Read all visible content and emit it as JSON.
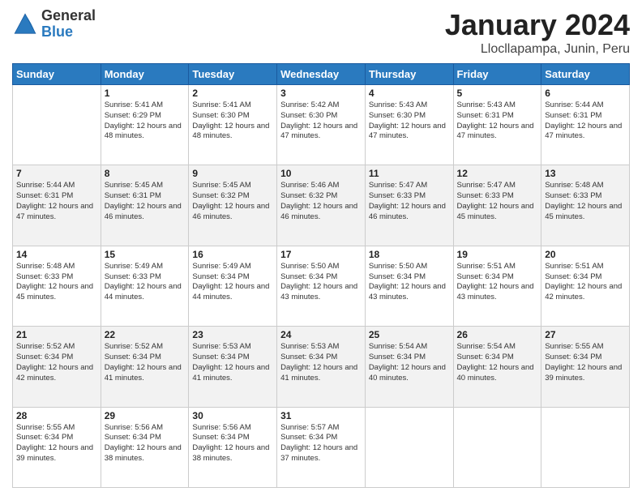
{
  "logo": {
    "general": "General",
    "blue": "Blue"
  },
  "title": {
    "month": "January 2024",
    "location": "Llocllapampa, Junin, Peru"
  },
  "days_header": [
    "Sunday",
    "Monday",
    "Tuesday",
    "Wednesday",
    "Thursday",
    "Friday",
    "Saturday"
  ],
  "weeks": [
    [
      {
        "day": "",
        "sunrise": "",
        "sunset": "",
        "daylight": ""
      },
      {
        "day": "1",
        "sunrise": "Sunrise: 5:41 AM",
        "sunset": "Sunset: 6:29 PM",
        "daylight": "Daylight: 12 hours and 48 minutes."
      },
      {
        "day": "2",
        "sunrise": "Sunrise: 5:41 AM",
        "sunset": "Sunset: 6:30 PM",
        "daylight": "Daylight: 12 hours and 48 minutes."
      },
      {
        "day": "3",
        "sunrise": "Sunrise: 5:42 AM",
        "sunset": "Sunset: 6:30 PM",
        "daylight": "Daylight: 12 hours and 47 minutes."
      },
      {
        "day": "4",
        "sunrise": "Sunrise: 5:43 AM",
        "sunset": "Sunset: 6:30 PM",
        "daylight": "Daylight: 12 hours and 47 minutes."
      },
      {
        "day": "5",
        "sunrise": "Sunrise: 5:43 AM",
        "sunset": "Sunset: 6:31 PM",
        "daylight": "Daylight: 12 hours and 47 minutes."
      },
      {
        "day": "6",
        "sunrise": "Sunrise: 5:44 AM",
        "sunset": "Sunset: 6:31 PM",
        "daylight": "Daylight: 12 hours and 47 minutes."
      }
    ],
    [
      {
        "day": "7",
        "sunrise": "Sunrise: 5:44 AM",
        "sunset": "Sunset: 6:31 PM",
        "daylight": "Daylight: 12 hours and 47 minutes."
      },
      {
        "day": "8",
        "sunrise": "Sunrise: 5:45 AM",
        "sunset": "Sunset: 6:31 PM",
        "daylight": "Daylight: 12 hours and 46 minutes."
      },
      {
        "day": "9",
        "sunrise": "Sunrise: 5:45 AM",
        "sunset": "Sunset: 6:32 PM",
        "daylight": "Daylight: 12 hours and 46 minutes."
      },
      {
        "day": "10",
        "sunrise": "Sunrise: 5:46 AM",
        "sunset": "Sunset: 6:32 PM",
        "daylight": "Daylight: 12 hours and 46 minutes."
      },
      {
        "day": "11",
        "sunrise": "Sunrise: 5:47 AM",
        "sunset": "Sunset: 6:33 PM",
        "daylight": "Daylight: 12 hours and 46 minutes."
      },
      {
        "day": "12",
        "sunrise": "Sunrise: 5:47 AM",
        "sunset": "Sunset: 6:33 PM",
        "daylight": "Daylight: 12 hours and 45 minutes."
      },
      {
        "day": "13",
        "sunrise": "Sunrise: 5:48 AM",
        "sunset": "Sunset: 6:33 PM",
        "daylight": "Daylight: 12 hours and 45 minutes."
      }
    ],
    [
      {
        "day": "14",
        "sunrise": "Sunrise: 5:48 AM",
        "sunset": "Sunset: 6:33 PM",
        "daylight": "Daylight: 12 hours and 45 minutes."
      },
      {
        "day": "15",
        "sunrise": "Sunrise: 5:49 AM",
        "sunset": "Sunset: 6:33 PM",
        "daylight": "Daylight: 12 hours and 44 minutes."
      },
      {
        "day": "16",
        "sunrise": "Sunrise: 5:49 AM",
        "sunset": "Sunset: 6:34 PM",
        "daylight": "Daylight: 12 hours and 44 minutes."
      },
      {
        "day": "17",
        "sunrise": "Sunrise: 5:50 AM",
        "sunset": "Sunset: 6:34 PM",
        "daylight": "Daylight: 12 hours and 43 minutes."
      },
      {
        "day": "18",
        "sunrise": "Sunrise: 5:50 AM",
        "sunset": "Sunset: 6:34 PM",
        "daylight": "Daylight: 12 hours and 43 minutes."
      },
      {
        "day": "19",
        "sunrise": "Sunrise: 5:51 AM",
        "sunset": "Sunset: 6:34 PM",
        "daylight": "Daylight: 12 hours and 43 minutes."
      },
      {
        "day": "20",
        "sunrise": "Sunrise: 5:51 AM",
        "sunset": "Sunset: 6:34 PM",
        "daylight": "Daylight: 12 hours and 42 minutes."
      }
    ],
    [
      {
        "day": "21",
        "sunrise": "Sunrise: 5:52 AM",
        "sunset": "Sunset: 6:34 PM",
        "daylight": "Daylight: 12 hours and 42 minutes."
      },
      {
        "day": "22",
        "sunrise": "Sunrise: 5:52 AM",
        "sunset": "Sunset: 6:34 PM",
        "daylight": "Daylight: 12 hours and 41 minutes."
      },
      {
        "day": "23",
        "sunrise": "Sunrise: 5:53 AM",
        "sunset": "Sunset: 6:34 PM",
        "daylight": "Daylight: 12 hours and 41 minutes."
      },
      {
        "day": "24",
        "sunrise": "Sunrise: 5:53 AM",
        "sunset": "Sunset: 6:34 PM",
        "daylight": "Daylight: 12 hours and 41 minutes."
      },
      {
        "day": "25",
        "sunrise": "Sunrise: 5:54 AM",
        "sunset": "Sunset: 6:34 PM",
        "daylight": "Daylight: 12 hours and 40 minutes."
      },
      {
        "day": "26",
        "sunrise": "Sunrise: 5:54 AM",
        "sunset": "Sunset: 6:34 PM",
        "daylight": "Daylight: 12 hours and 40 minutes."
      },
      {
        "day": "27",
        "sunrise": "Sunrise: 5:55 AM",
        "sunset": "Sunset: 6:34 PM",
        "daylight": "Daylight: 12 hours and 39 minutes."
      }
    ],
    [
      {
        "day": "28",
        "sunrise": "Sunrise: 5:55 AM",
        "sunset": "Sunset: 6:34 PM",
        "daylight": "Daylight: 12 hours and 39 minutes."
      },
      {
        "day": "29",
        "sunrise": "Sunrise: 5:56 AM",
        "sunset": "Sunset: 6:34 PM",
        "daylight": "Daylight: 12 hours and 38 minutes."
      },
      {
        "day": "30",
        "sunrise": "Sunrise: 5:56 AM",
        "sunset": "Sunset: 6:34 PM",
        "daylight": "Daylight: 12 hours and 38 minutes."
      },
      {
        "day": "31",
        "sunrise": "Sunrise: 5:57 AM",
        "sunset": "Sunset: 6:34 PM",
        "daylight": "Daylight: 12 hours and 37 minutes."
      },
      {
        "day": "",
        "sunrise": "",
        "sunset": "",
        "daylight": ""
      },
      {
        "day": "",
        "sunrise": "",
        "sunset": "",
        "daylight": ""
      },
      {
        "day": "",
        "sunrise": "",
        "sunset": "",
        "daylight": ""
      }
    ]
  ]
}
